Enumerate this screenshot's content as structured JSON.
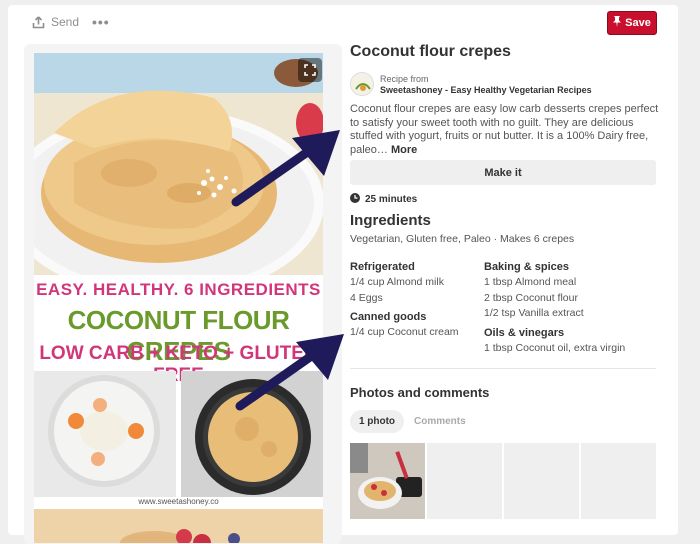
{
  "topbar": {
    "send_label": "Send",
    "more_label": "•••",
    "save_label": "Save"
  },
  "pin_image": {
    "banner_line1": "EASY. HEALTHY. 6 INGREDIENTS",
    "banner_line2": "COCONUT FLOUR CREPES",
    "banner_line3": "LOW CARB + KETO + GLUTEN FREE",
    "watermark": "www.sweetashoney.co"
  },
  "pin": {
    "title": "Coconut flour crepes",
    "recipe_from": "Recipe from",
    "source": "Sweetashoney - Easy Healthy Vegetarian Recipes",
    "description": "Coconut flour crepes are easy low carb desserts crepes perfect to satisfy your sweet tooth with no guilt. They are delicious stuffed with yogurt, fruits or nut butter. It is a 100% Dairy free, paleo…",
    "more_label": "More",
    "make_it_label": "Make it",
    "time": "25 minutes"
  },
  "ingredients": {
    "title": "Ingredients",
    "tags": "Vegetarian, Gluten free, Paleo · Makes 6 crepes",
    "col1": [
      {
        "heading": "Refrigerated",
        "items": [
          "1/4 cup Almond milk",
          "4 Eggs"
        ]
      },
      {
        "heading": "Canned goods",
        "items": [
          "1/4 cup Coconut cream"
        ]
      }
    ],
    "col2": [
      {
        "heading": "Baking & spices",
        "items": [
          "1 tbsp Almond meal",
          "2 tbsp Coconut flour",
          "1/2 tsp Vanilla extract"
        ]
      },
      {
        "heading": "Oils & vinegars",
        "items": [
          "1 tbsp Coconut oil, extra virgin"
        ]
      }
    ]
  },
  "photos": {
    "title": "Photos and comments",
    "tab_photo": "1 photo",
    "tab_comments": "Comments"
  },
  "colors": {
    "save_red": "#c8102e",
    "arrow_navy": "#1f1a5a",
    "banner_pink": "#d2367a",
    "banner_green": "#6a9a2b"
  },
  "icons": [
    "share-icon",
    "more-icon",
    "pin-icon",
    "expand-icon",
    "clock-icon"
  ]
}
